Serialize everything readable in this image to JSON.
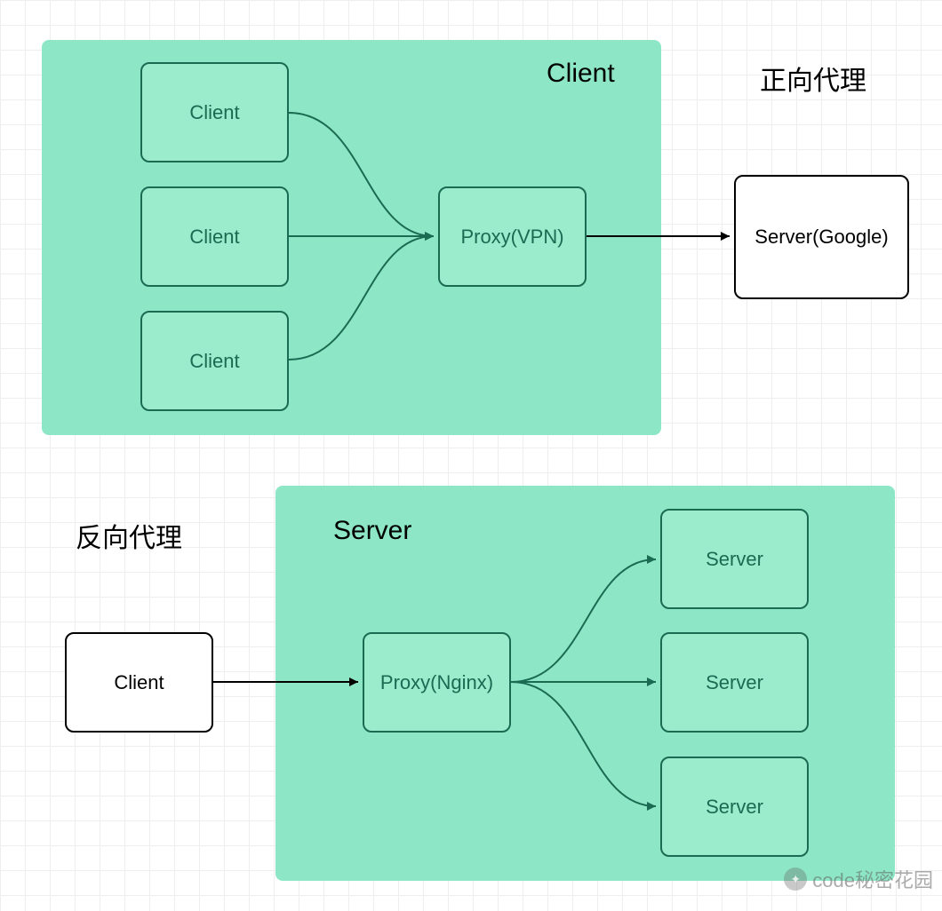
{
  "forward_proxy": {
    "title": "正向代理",
    "zone_label": "Client",
    "clients": [
      "Client",
      "Client",
      "Client"
    ],
    "proxy_label": "Proxy(VPN)",
    "server_label": "Server(Google)"
  },
  "reverse_proxy": {
    "title": "反向代理",
    "zone_label": "Server",
    "client_label": "Client",
    "proxy_label": "Proxy(Nginx)",
    "servers": [
      "Server",
      "Server",
      "Server"
    ]
  },
  "watermark": "code秘密花园",
  "colors": {
    "zone_bg": "#8de7c7",
    "node_bg": "#9bebcd",
    "node_border": "#1b6b53",
    "arrow_dark": "#1b6b53",
    "arrow_black": "#000000"
  }
}
